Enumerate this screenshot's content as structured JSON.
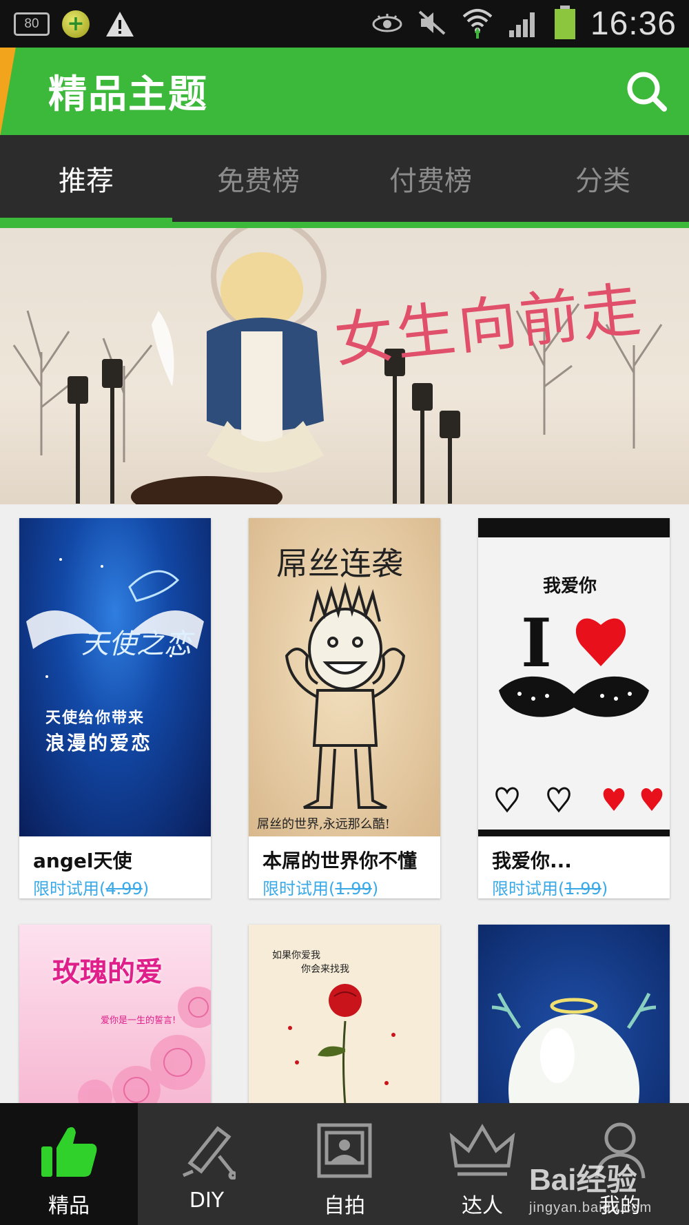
{
  "status_bar": {
    "battery_left_label": "80",
    "time": "16:36"
  },
  "header": {
    "title": "精品主题"
  },
  "tabs": [
    {
      "label": "推荐",
      "active": true
    },
    {
      "label": "免费榜",
      "active": false
    },
    {
      "label": "付费榜",
      "active": false
    },
    {
      "label": "分类",
      "active": false
    }
  ],
  "banner": {
    "caption": "女生向前走",
    "page_count": 4,
    "active_page": 1
  },
  "themes": [
    {
      "name": "angel天使",
      "price_prefix": "限时试用(",
      "price": "4.99",
      "price_suffix": ")",
      "thumb_text": [
        "天使之恋",
        "天使给你带来",
        "浪漫的爱恋"
      ]
    },
    {
      "name": "本屌的世界你不懂",
      "price_prefix": "限时试用(",
      "price": "1.99",
      "price_suffix": ")",
      "thumb_text": [
        "屌丝连袭",
        "屌丝的世界,永远那么酷!"
      ]
    },
    {
      "name": "我爱你...",
      "price_prefix": "限时试用(",
      "price": "1.99",
      "price_suffix": ")",
      "thumb_text": [
        "我爱你",
        "I"
      ]
    },
    {
      "name": "",
      "thumb_text": [
        "玫瑰的爱",
        "爱你是一生的誓言!"
      ]
    },
    {
      "name": "",
      "thumb_text": [
        "如果你爱我",
        "你会来找我"
      ]
    },
    {
      "name": "",
      "thumb_text": []
    }
  ],
  "bottom_nav": [
    {
      "label": "精品",
      "icon": "thumbs-up-icon",
      "active": true
    },
    {
      "label": "DIY",
      "icon": "paint-roller-icon",
      "active": false
    },
    {
      "label": "自拍",
      "icon": "picture-frame-icon",
      "active": false
    },
    {
      "label": "达人",
      "icon": "crown-icon",
      "active": false
    },
    {
      "label": "我的",
      "icon": "person-icon",
      "active": false
    }
  ],
  "watermark": {
    "brand": "Bai经验",
    "url": "jingyan.baidu.com"
  },
  "colors": {
    "accent": "#3cb83a",
    "header": "#3cb83a",
    "tab_bar": "#2c2c2c",
    "price": "#3aa9e8",
    "nav_bar": "#2f2f2f"
  }
}
